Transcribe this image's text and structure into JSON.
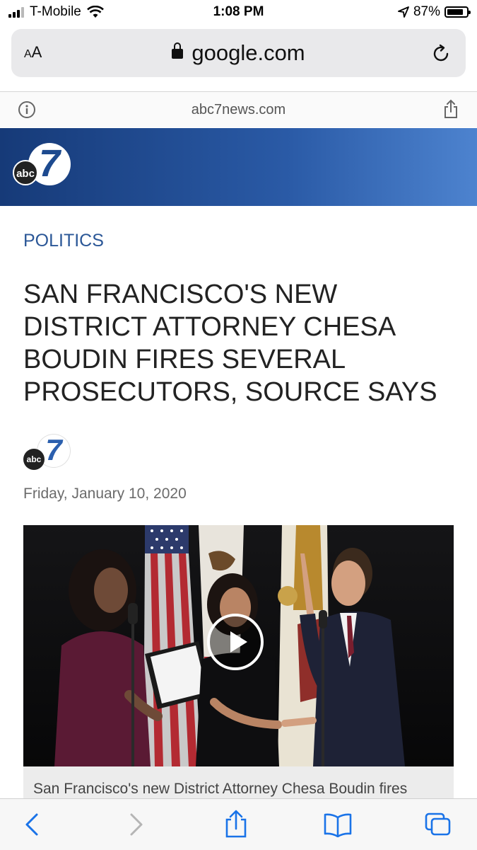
{
  "status_bar": {
    "carrier": "T-Mobile",
    "time": "1:08 PM",
    "battery_text": "87%",
    "battery_level": 0.87
  },
  "url_bar": {
    "text_size_label": "AA",
    "domain": "google.com"
  },
  "amp_bar": {
    "host": "abc7news.com"
  },
  "header": {
    "logo_abc": "abc",
    "logo_number": "7"
  },
  "article": {
    "category": "POLITICS",
    "headline": "SAN FRANCISCO'S NEW DISTRICT ATTORNEY CHESA BOUDIN FIRES SEVERAL PROSECUTORS, SOURCE SAYS",
    "date": "Friday, January 10, 2020",
    "caption": "San Francisco's new District Attorney Chesa Boudin fires"
  },
  "colors": {
    "category": "#2b5797",
    "ios_blue": "#1a73e8",
    "header_dark": "#163a78",
    "header_light": "#4d83cf"
  }
}
